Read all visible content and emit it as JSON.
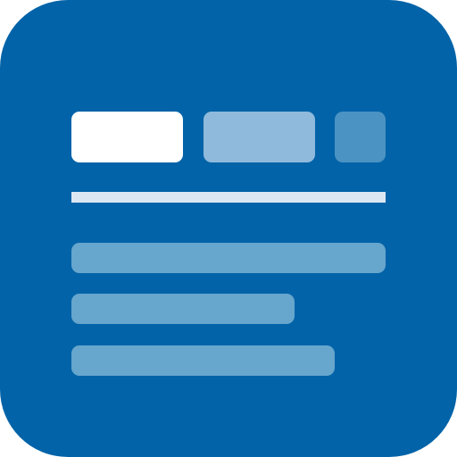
{
  "icon": {
    "name": "document-list-app-icon",
    "background_color": "#0263a8"
  },
  "tabs": [
    {
      "name": "active-tab",
      "color": "#ffffff"
    },
    {
      "name": "secondary-tab",
      "color": "#8fbadb"
    },
    {
      "name": "small-tab",
      "color": "#4b93c3"
    }
  ],
  "divider": {
    "color": "#dbe8f3"
  },
  "content_lines": [
    {
      "name": "content-line-1",
      "color": "#67a6cd"
    },
    {
      "name": "content-line-2",
      "color": "#67a6cd"
    },
    {
      "name": "content-line-3",
      "color": "#67a6cd"
    }
  ]
}
